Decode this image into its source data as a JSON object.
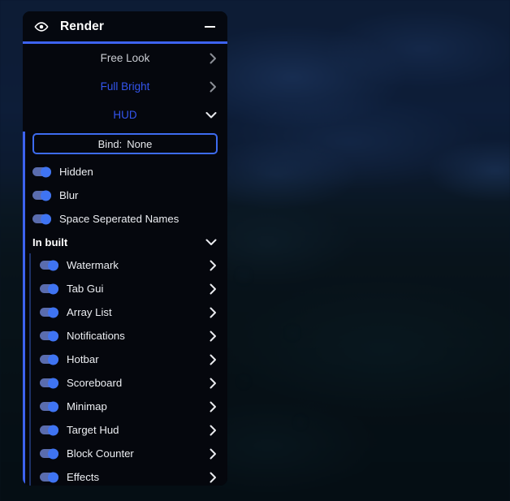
{
  "window": {
    "title": "Render",
    "icon": "eye-icon",
    "minimize_label": "—",
    "accent_color": "#3d63ef",
    "background_color": "#05070d",
    "enabled_text_color": "#3355ee",
    "disabled_text_color": "#c9ccd2"
  },
  "modules": [
    {
      "label": "Free Look",
      "enabled": false,
      "chevron": "chevron-right-icon"
    },
    {
      "label": "Full Bright",
      "enabled": true,
      "chevron": "chevron-right-icon"
    },
    {
      "label": "HUD",
      "enabled": true,
      "chevron": "chevron-down-icon"
    }
  ],
  "bind": {
    "label": "Bind:",
    "value": "None"
  },
  "settings": [
    {
      "label": "Hidden",
      "toggle": true
    },
    {
      "label": "Blur",
      "toggle": true
    },
    {
      "label": "Space Seperated Names",
      "toggle": true
    }
  ],
  "group": {
    "title": "In built",
    "expanded": true,
    "chevron": "chevron-down-icon",
    "items": [
      {
        "label": "Watermark",
        "toggle": true,
        "chevron": "chevron-right-icon"
      },
      {
        "label": "Tab Gui",
        "toggle": true,
        "chevron": "chevron-right-icon"
      },
      {
        "label": "Array List",
        "toggle": true,
        "chevron": "chevron-right-icon"
      },
      {
        "label": "Notifications",
        "toggle": true,
        "chevron": "chevron-right-icon"
      },
      {
        "label": "Hotbar",
        "toggle": true,
        "chevron": "chevron-right-icon"
      },
      {
        "label": "Scoreboard",
        "toggle": true,
        "chevron": "chevron-right-icon"
      },
      {
        "label": "Minimap",
        "toggle": true,
        "chevron": "chevron-right-icon"
      },
      {
        "label": "Target Hud",
        "toggle": true,
        "chevron": "chevron-right-icon"
      },
      {
        "label": "Block Counter",
        "toggle": true,
        "chevron": "chevron-right-icon"
      },
      {
        "label": "Effects",
        "toggle": true,
        "chevron": "chevron-right-icon"
      }
    ]
  }
}
